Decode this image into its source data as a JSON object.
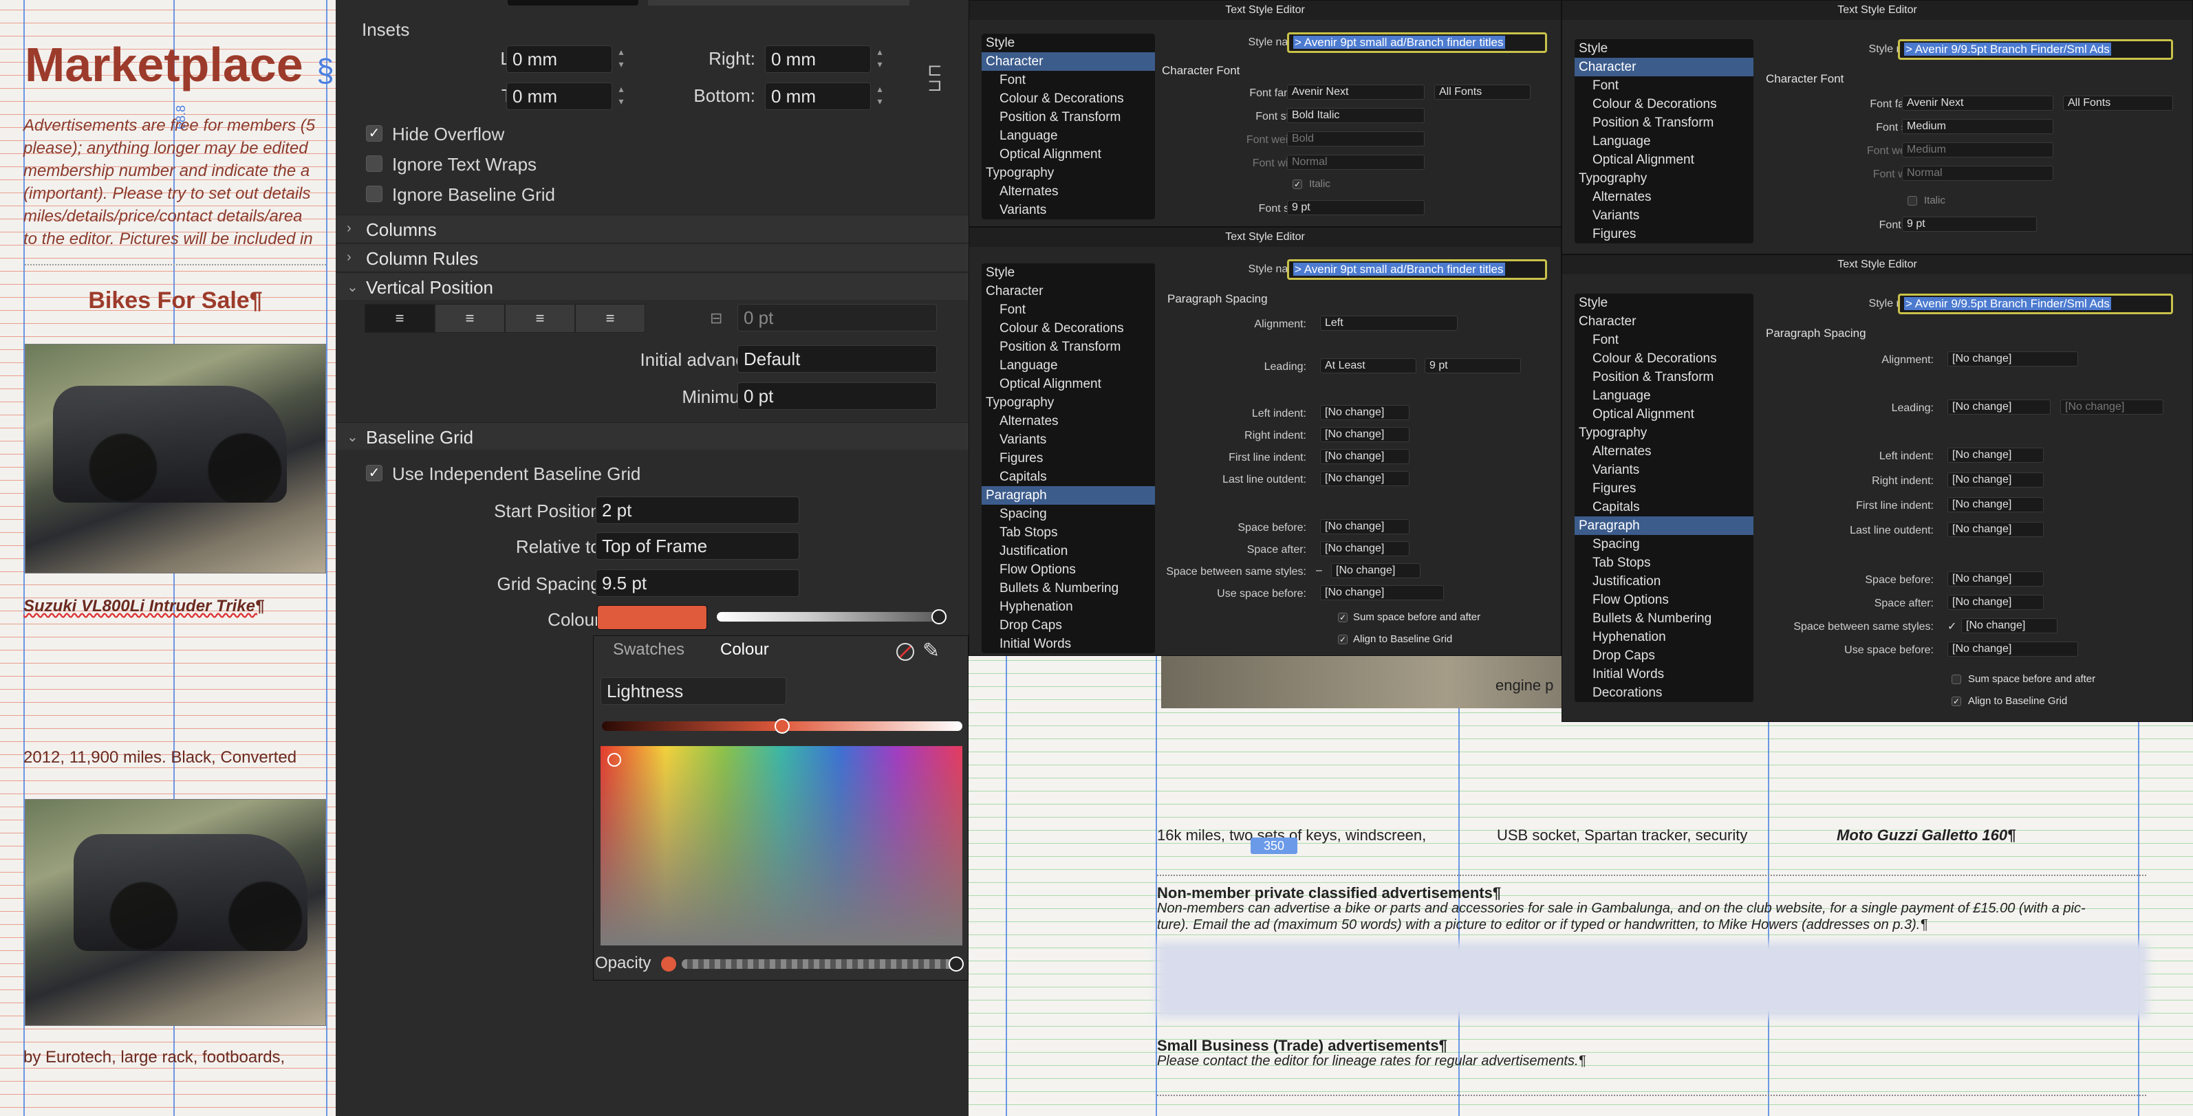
{
  "left_doc": {
    "title": "Marketplace",
    "title_mark": "§",
    "intro": [
      "Advertisements are free for members (5",
      "please); anything longer may be edited",
      "membership number and indicate the a",
      "(important). Please try to set out details",
      "miles/details/price/contact details/area",
      "to the editor. Pictures will be included in"
    ],
    "ruler_label": "68.8",
    "section_heading": "Bikes For Sale¶",
    "ad1_title": "Suzuki VL800Li Intruder Trike¶",
    "ad1_text": "2012, 11,900 miles. Black, Converted",
    "ad2_text": "by Eurotech, large rack, footboards,"
  },
  "panel": {
    "insets": {
      "heading": "Insets",
      "left_label": "Left:",
      "left": "0 mm",
      "right_label": "Right:",
      "right": "0 mm",
      "top_label": "Top:",
      "top": "0 mm",
      "bottom_label": "Bottom:",
      "bottom": "0 mm"
    },
    "checks": [
      {
        "label": "Hide Overflow",
        "checked": true
      },
      {
        "label": "Ignore Text Wraps",
        "checked": false
      },
      {
        "label": "Ignore Baseline Grid",
        "checked": false
      }
    ],
    "sections": {
      "columns": "Columns",
      "column_rules": "Column Rules",
      "vertical_position": "Vertical Position",
      "baseline_grid": "Baseline Grid"
    },
    "vertical": {
      "offset": "0 pt",
      "initial_advance_label": "Initial advance:",
      "initial_advance": "Default",
      "minimum_label": "Minimum:",
      "minimum": "0 pt"
    },
    "baseline": {
      "use_independent": "Use Independent Baseline Grid",
      "start_label": "Start Position:",
      "start": "2 pt",
      "relative_label": "Relative to:",
      "relative": "Top of Frame",
      "spacing_label": "Grid Spacing:",
      "spacing": "9.5 pt",
      "colour_label": "Colour:",
      "colour": "#e05a3c"
    }
  },
  "colour_popup": {
    "tabs": [
      "Swatches",
      "Colour"
    ],
    "active_tab": "Colour",
    "mode": "Lightness",
    "opacity_label": "Opacity",
    "lightness": 0.5
  },
  "dialog_common": {
    "title": "Text Style Editor",
    "style_label": "Style name:"
  },
  "dialog1": {
    "style_name": "> Avenir 9pt small ad/Branch finder titles",
    "sidebar": [
      "Style",
      "Character",
      "Font",
      "Colour & Decorations",
      "Position & Transform",
      "Language",
      "Optical Alignment",
      "Typography",
      "Alternates",
      "Variants"
    ],
    "selected": "Character",
    "heading": "Character Font",
    "font_family_label": "Font family:",
    "font_family": "Avenir Next",
    "font_set": "All Fonts",
    "font_style_label": "Font style:",
    "font_style": "Bold Italic",
    "font_weight_label": "Font weight:",
    "font_weight": "Bold",
    "font_width_label": "Font width:",
    "font_width": "Normal",
    "italic": "Italic",
    "font_size_label": "Font size:",
    "font_size": "9 pt"
  },
  "dialog2": {
    "style_name": "> Avenir 9/9.5pt Branch Finder/Sml Ads",
    "sidebar": [
      "Style",
      "Character",
      "Font",
      "Colour & Decorations",
      "Position & Transform",
      "Language",
      "Optical Alignment",
      "Typography",
      "Alternates",
      "Variants",
      "Figures"
    ],
    "selected": "Character",
    "heading": "Character Font",
    "font_family": "Avenir Next",
    "font_set": "All Fonts",
    "font_style": "Medium",
    "font_weight": "Medium",
    "font_width": "Normal",
    "italic": "Italic",
    "font_size": "9 pt"
  },
  "dialog3": {
    "style_name": "> Avenir 9pt small ad/Branch finder titles",
    "sidebar": [
      "Style",
      "Character",
      "Font",
      "Colour & Decorations",
      "Position & Transform",
      "Language",
      "Optical Alignment",
      "Typography",
      "Alternates",
      "Variants",
      "Figures",
      "Capitals",
      "Paragraph",
      "Spacing",
      "Tab Stops",
      "Justification",
      "Flow Options",
      "Bullets & Numbering",
      "Hyphenation",
      "Drop Caps",
      "Initial Words"
    ],
    "selected": "Paragraph",
    "heading": "Paragraph Spacing",
    "alignment_label": "Alignment:",
    "alignment": "Left",
    "leading_label": "Leading:",
    "leading": "At Least",
    "leading_val": "9 pt",
    "left_indent_label": "Left indent:",
    "right_indent_label": "Right indent:",
    "first_indent_label": "First line indent:",
    "last_outdent_label": "Last line outdent:",
    "no_change": "[No change]",
    "space_before_label": "Space before:",
    "space_after_label": "Space after:",
    "between_label": "Space between same styles:",
    "between_prefix": "–",
    "use_before_label": "Use space before:",
    "sum": "Sum space before and after",
    "align_grid": "Align to Baseline Grid"
  },
  "dialog4": {
    "style_name": "> Avenir 9/9.5pt Branch Finder/Sml Ads",
    "sidebar": [
      "Style",
      "Character",
      "Font",
      "Colour & Decorations",
      "Position & Transform",
      "Language",
      "Optical Alignment",
      "Typography",
      "Alternates",
      "Variants",
      "Figures",
      "Capitals",
      "Paragraph",
      "Spacing",
      "Tab Stops",
      "Justification",
      "Flow Options",
      "Bullets & Numbering",
      "Hyphenation",
      "Drop Caps",
      "Initial Words",
      "Decorations"
    ],
    "selected": "Paragraph",
    "heading": "Paragraph Spacing",
    "between_prefix": "✓"
  },
  "right_doc": {
    "engine": "engine p",
    "col1": "16k miles, two sets of keys, windscreen,",
    "col2": "USB socket, Spartan tracker, security",
    "col3": "Moto Guzzi Galletto 160¶",
    "ruler": "350",
    "nm_heading": "Non-member private classified advertisements¶",
    "nm_text1": "Non-members can advertise a bike or parts and accessories for sale in Gambalunga, and on the club website, for a single payment of £15.00 (with a pic-",
    "nm_text2": "ture). Email the ad (maximum 50 words) with a picture to editor or if typed or handwritten, to Mike Howers (addresses on p.3).¶",
    "sb_heading": "Small Business (Trade) advertisements¶",
    "sb_text": "Please contact the editor for lineage rates for regular advertisements.¶"
  }
}
